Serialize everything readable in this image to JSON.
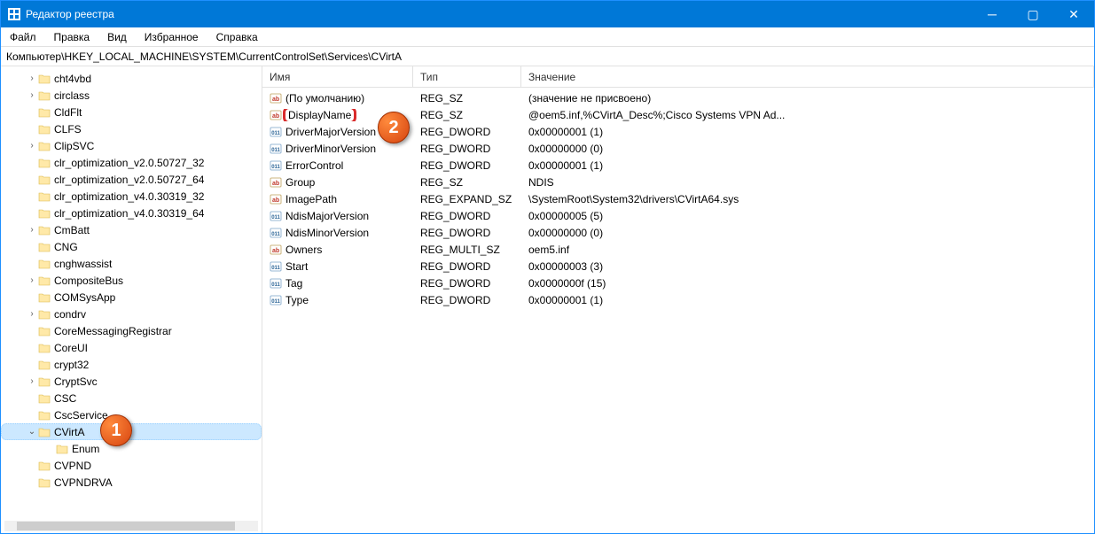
{
  "window": {
    "title": "Редактор реестра"
  },
  "menubar": [
    "Файл",
    "Правка",
    "Вид",
    "Избранное",
    "Справка"
  ],
  "address": "Компьютер\\HKEY_LOCAL_MACHINE\\SYSTEM\\CurrentControlSet\\Services\\CVirtA",
  "tree": [
    {
      "label": "cht4vbd",
      "exp": ">"
    },
    {
      "label": "circlass",
      "exp": ">"
    },
    {
      "label": "CldFlt",
      "exp": ""
    },
    {
      "label": "CLFS",
      "exp": ""
    },
    {
      "label": "ClipSVC",
      "exp": ">"
    },
    {
      "label": "clr_optimization_v2.0.50727_32",
      "exp": ""
    },
    {
      "label": "clr_optimization_v2.0.50727_64",
      "exp": ""
    },
    {
      "label": "clr_optimization_v4.0.30319_32",
      "exp": ""
    },
    {
      "label": "clr_optimization_v4.0.30319_64",
      "exp": ""
    },
    {
      "label": "CmBatt",
      "exp": ">"
    },
    {
      "label": "CNG",
      "exp": ""
    },
    {
      "label": "cnghwassist",
      "exp": ""
    },
    {
      "label": "CompositeBus",
      "exp": ">"
    },
    {
      "label": "COMSysApp",
      "exp": ""
    },
    {
      "label": "condrv",
      "exp": ">"
    },
    {
      "label": "CoreMessagingRegistrar",
      "exp": ""
    },
    {
      "label": "CoreUI",
      "exp": ""
    },
    {
      "label": "crypt32",
      "exp": ""
    },
    {
      "label": "CryptSvc",
      "exp": ">"
    },
    {
      "label": "CSC",
      "exp": ""
    },
    {
      "label": "CscService",
      "exp": "",
      "hidden_by_callout": true
    },
    {
      "label": "CVirtA",
      "exp": "v",
      "selected": true,
      "highlighted": true
    },
    {
      "label": "Enum",
      "exp": "",
      "level": 2
    },
    {
      "label": "CVPND",
      "exp": ""
    },
    {
      "label": "CVPNDRVA",
      "exp": ""
    }
  ],
  "columns": {
    "name": "Имя",
    "type": "Тип",
    "value": "Значение"
  },
  "values": [
    {
      "name": "(По умолчанию)",
      "type": "REG_SZ",
      "value": "(значение не присвоено)",
      "icon": "string"
    },
    {
      "name": "DisplayName",
      "type": "REG_SZ",
      "value": "@oem5.inf,%CVirtA_Desc%;Cisco Systems VPN Ad...",
      "icon": "string",
      "highlighted": true
    },
    {
      "name": "DriverMajorVersion",
      "type": "REG_DWORD",
      "value": "0x00000001 (1)",
      "icon": "dword"
    },
    {
      "name": "DriverMinorVersion",
      "type": "REG_DWORD",
      "value": "0x00000000 (0)",
      "icon": "dword"
    },
    {
      "name": "ErrorControl",
      "type": "REG_DWORD",
      "value": "0x00000001 (1)",
      "icon": "dword"
    },
    {
      "name": "Group",
      "type": "REG_SZ",
      "value": "NDIS",
      "icon": "string"
    },
    {
      "name": "ImagePath",
      "type": "REG_EXPAND_SZ",
      "value": "\\SystemRoot\\System32\\drivers\\CVirtA64.sys",
      "icon": "string"
    },
    {
      "name": "NdisMajorVersion",
      "type": "REG_DWORD",
      "value": "0x00000005 (5)",
      "icon": "dword"
    },
    {
      "name": "NdisMinorVersion",
      "type": "REG_DWORD",
      "value": "0x00000000 (0)",
      "icon": "dword"
    },
    {
      "name": "Owners",
      "type": "REG_MULTI_SZ",
      "value": "oem5.inf",
      "icon": "string"
    },
    {
      "name": "Start",
      "type": "REG_DWORD",
      "value": "0x00000003 (3)",
      "icon": "dword"
    },
    {
      "name": "Tag",
      "type": "REG_DWORD",
      "value": "0x0000000f (15)",
      "icon": "dword"
    },
    {
      "name": "Type",
      "type": "REG_DWORD",
      "value": "0x00000001 (1)",
      "icon": "dword"
    }
  ],
  "callouts": {
    "tree": "1",
    "value": "2"
  }
}
